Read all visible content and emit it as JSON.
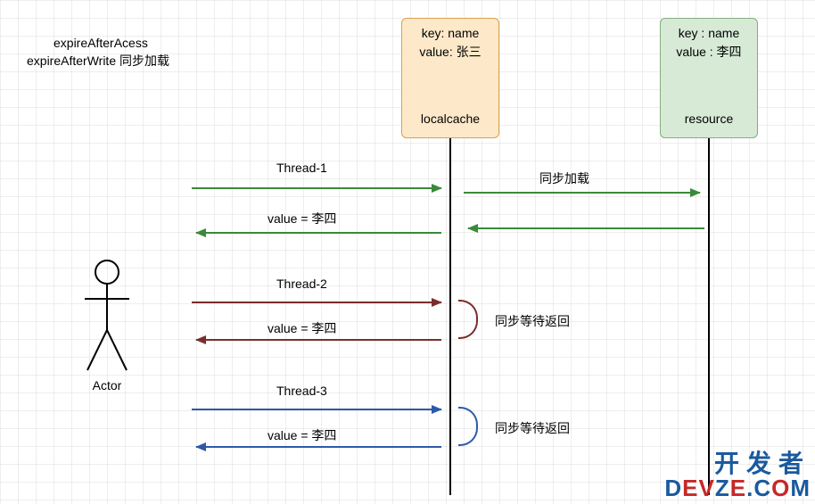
{
  "title": {
    "line1": "expireAfterAcess",
    "line2": "expireAfterWrite 同步加载"
  },
  "localcache": {
    "key_label": "key: name",
    "value_label": "value: 张三",
    "name": "localcache"
  },
  "resource": {
    "key_label": "key : name",
    "value_label": "value : 李四",
    "name": "resource"
  },
  "actor": {
    "label": "Actor"
  },
  "arrows": {
    "thread1_req": "Thread-1",
    "thread1_resp": "value = 李四",
    "sync_load": "同步加载",
    "thread2_req": "Thread-2",
    "thread2_resp": "value = 李四",
    "thread2_wait": "同步等待返回",
    "thread3_req": "Thread-3",
    "thread3_resp": "value = 李四",
    "thread3_wait": "同步等待返回"
  },
  "watermark": {
    "line1": "开发者",
    "line2_a": "D",
    "line2_b": "EV",
    "line2_c": "Z",
    "line2_d": "E",
    "line2_e": ".C",
    "line2_f": "O",
    "line2_g": "M"
  },
  "chart_data": {
    "type": "sequence-diagram",
    "title": "expireAfterAccess / expireAfterWrite 同步加载",
    "participants": [
      "Actor",
      "localcache",
      "resource"
    ],
    "localcache_state": {
      "key": "name",
      "value": "张三"
    },
    "resource_state": {
      "key": "name",
      "value": "李四"
    },
    "messages": [
      {
        "from": "Actor",
        "to": "localcache",
        "label": "Thread-1",
        "color": "green"
      },
      {
        "from": "localcache",
        "to": "resource",
        "label": "同步加载",
        "color": "green"
      },
      {
        "from": "resource",
        "to": "localcache",
        "label": "",
        "color": "green"
      },
      {
        "from": "localcache",
        "to": "Actor",
        "label": "value = 李四",
        "color": "green"
      },
      {
        "from": "Actor",
        "to": "localcache",
        "label": "Thread-2",
        "color": "darkred",
        "note": "同步等待返回"
      },
      {
        "from": "localcache",
        "to": "Actor",
        "label": "value = 李四",
        "color": "darkred"
      },
      {
        "from": "Actor",
        "to": "localcache",
        "label": "Thread-3",
        "color": "blue",
        "note": "同步等待返回"
      },
      {
        "from": "localcache",
        "to": "Actor",
        "label": "value = 李四",
        "color": "blue"
      }
    ]
  }
}
